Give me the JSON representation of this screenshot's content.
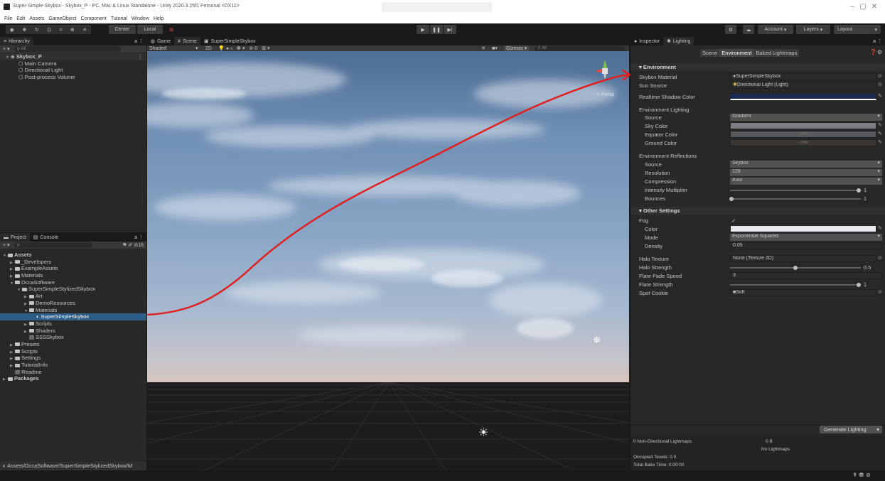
{
  "window": {
    "title": "Super-Simple-Skybox - Skybox_P - PC, Mac & Linux Standalone - Unity 2020.3.25f1 Personal <DX11>",
    "min": "–",
    "max": "▢",
    "close": "✕"
  },
  "menu": [
    "File",
    "Edit",
    "Assets",
    "GameObject",
    "Component",
    "Tutorial",
    "Window",
    "Help"
  ],
  "toolbar": {
    "center": "Center",
    "local": "Local",
    "account": "Account",
    "layers": "Layers",
    "layout": "Layout",
    "play": "▶",
    "pause": "❚❚",
    "step": "▶|"
  },
  "hierarchy": {
    "tab": "Hierarchy",
    "search": "All",
    "scene": "Skybox_P",
    "items": [
      "Main Camera",
      "Directional Light",
      "Post-process Volume"
    ]
  },
  "project": {
    "tabs": [
      "Project",
      "Console"
    ],
    "count": "16",
    "tree": [
      {
        "label": "Assets",
        "level": 0,
        "open": true,
        "bold": true
      },
      {
        "label": "_Developers",
        "level": 1
      },
      {
        "label": "ExampleAssets",
        "level": 1
      },
      {
        "label": "Materials",
        "level": 1
      },
      {
        "label": "OccaSoftware",
        "level": 1,
        "open": true
      },
      {
        "label": "SuperSimpleStylizedSkybox",
        "level": 2,
        "open": true
      },
      {
        "label": "Art",
        "level": 3
      },
      {
        "label": "DemoResources",
        "level": 3
      },
      {
        "label": "Materials",
        "level": 3,
        "open": true
      },
      {
        "label": "SuperSimpleSkybox",
        "level": 4,
        "selected": true,
        "icon": "material"
      },
      {
        "label": "Scripts",
        "level": 3
      },
      {
        "label": "Shaders",
        "level": 3
      },
      {
        "label": "SSSSkybox",
        "level": 3,
        "icon": "file"
      },
      {
        "label": "Presets",
        "level": 1
      },
      {
        "label": "Scripts",
        "level": 1
      },
      {
        "label": "Settings",
        "level": 1
      },
      {
        "label": "TutorialInfo",
        "level": 1
      },
      {
        "label": "Readme",
        "level": 1,
        "icon": "file"
      },
      {
        "label": "Packages",
        "level": 0,
        "bold": true
      }
    ],
    "path": "Assets/OccaSoftware/SuperSimpleStylizedSkybox/M"
  },
  "scene": {
    "tabs": [
      "Game",
      "Scene",
      "SuperSimpleSkybox"
    ],
    "shading": "Shaded",
    "mode2d": "2D",
    "gizmos": "Gizmos",
    "search": "All",
    "persp": "< Persp"
  },
  "inspector": {
    "tabs": [
      "Inspector",
      "Lighting"
    ],
    "subtabs": [
      "Scene",
      "Environment",
      "Baked Lightmaps"
    ],
    "environment": "Environment",
    "skybox_label": "Skybox Material",
    "skybox_value": "SuperSimpleSkybox",
    "sun_label": "Sun Source",
    "sun_value": "Directional Light (Light)",
    "shadow_label": "Realtime Shadow Color",
    "env_lighting": "Environment Lighting",
    "source_label": "Source",
    "source_value": "Gradient",
    "sky_label": "Sky Color",
    "equator_label": "Equator Color",
    "ground_label": "Ground Color",
    "hdr": "HDR",
    "env_reflections": "Environment Reflections",
    "rsource_label": "Source",
    "rsource_value": "Skybox",
    "resolution_label": "Resolution",
    "resolution_value": "128",
    "compression_label": "Compression",
    "compression_value": "Auto",
    "intensity_label": "Intensity Multiplier",
    "intensity_value": "1",
    "bounces_label": "Bounces",
    "bounces_value": "1",
    "other": "Other Settings",
    "fog_label": "Fog",
    "fog_check": "✓",
    "color_label": "Color",
    "mode_label": "Mode",
    "mode_value": "Exponential Squared",
    "density_label": "Density",
    "density_value": "0.05",
    "halo_tex_label": "Halo Texture",
    "halo_tex_value": "None (Texture 2D)",
    "halo_str_label": "Halo Strength",
    "halo_str_value": "0.5",
    "flare_fade_label": "Flare Fade Speed",
    "flare_fade_value": "3",
    "flare_str_label": "Flare Strength",
    "flare_str_value": "1",
    "cookie_label": "Spot Cookie",
    "cookie_value": "Soft",
    "generate": "Generate Lighting",
    "lm_count": "0 Non-Directional Lightmaps",
    "lm_size": "0 B",
    "lm_none": "No Lightmaps",
    "texels": "Occupied Texels: 0.0",
    "bake_time": "Total Bake Time: 0:00:00"
  },
  "colors": {
    "annotation": "#e02020",
    "selection": "#2c5d87"
  }
}
